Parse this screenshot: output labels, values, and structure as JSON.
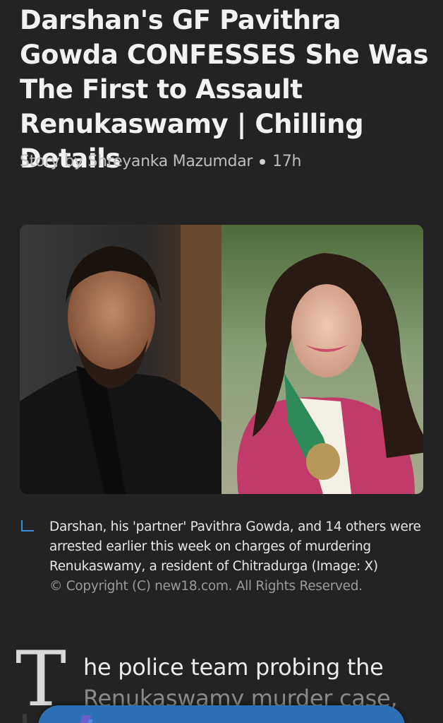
{
  "article": {
    "title": "Darshan's GF Pavithra Gowda CONFESSES She Was The First to Assault Renukaswamy | Chilling Details",
    "author": "Story by Shreyanka Mazumdar",
    "age": "17h"
  },
  "image": {
    "caption": "Darshan, his 'partner' Pavithra Gowda, and 14 others were arrested earlier this week on charges of murdering Renukaswamy, a resident of Chitradurga (Image: X)",
    "copyright": "© Copyright (C) new18.com. All Rights Reserved."
  },
  "body": {
    "drop_cap": "T",
    "line1": "he police team probing the",
    "line2": "Renukaswamy murder case,"
  },
  "action_bar": {
    "icon": "copilot-icon",
    "label": ""
  },
  "colors": {
    "background": "#232323",
    "accent": "#3b8ee6",
    "action_bar": "#2d6fb4"
  }
}
